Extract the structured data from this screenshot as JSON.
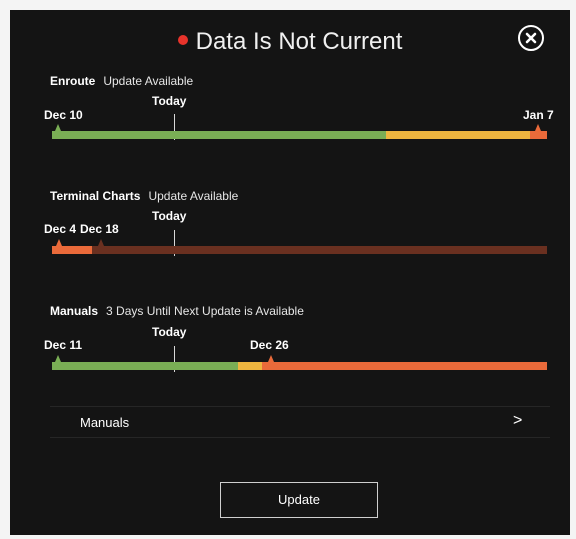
{
  "title": "Data Is Not Current",
  "colors": {
    "status_dot": "#e8332b",
    "green": "#7aae55",
    "yellow": "#efb63f",
    "orange": "#ea6a3a",
    "dark_red": "#6a3020"
  },
  "sections": [
    {
      "name": "Enroute",
      "status": "Update Available",
      "today_label": "Today",
      "start_label": "Dec 10",
      "end_label": "Jan 7",
      "segments": [
        {
          "color": "green",
          "fraction": 0.675
        },
        {
          "color": "yellow",
          "fraction": 0.29
        },
        {
          "color": "orange",
          "fraction": 0.035
        }
      ]
    },
    {
      "name": "Terminal Charts",
      "status": "Update Available",
      "today_label": "Today",
      "start_label": "Dec 4",
      "mid_label": "Dec 18",
      "segments": [
        {
          "color": "orange",
          "fraction": 0.08
        },
        {
          "color": "dark_red",
          "fraction": 0.92
        }
      ]
    },
    {
      "name": "Manuals",
      "status": "3 Days Until Next Update is Available",
      "today_label": "Today",
      "start_label": "Dec 11",
      "mid_label": "Dec 26",
      "segments": [
        {
          "color": "green",
          "fraction": 0.375
        },
        {
          "color": "yellow",
          "fraction": 0.05
        },
        {
          "color": "orange",
          "fraction": 0.575
        }
      ]
    }
  ],
  "manuals_row": {
    "label": "Manuals",
    "chevron": ">"
  },
  "update_button": "Update",
  "icons": {
    "close": "close-circle-icon",
    "chevron": "chevron-right-icon"
  }
}
